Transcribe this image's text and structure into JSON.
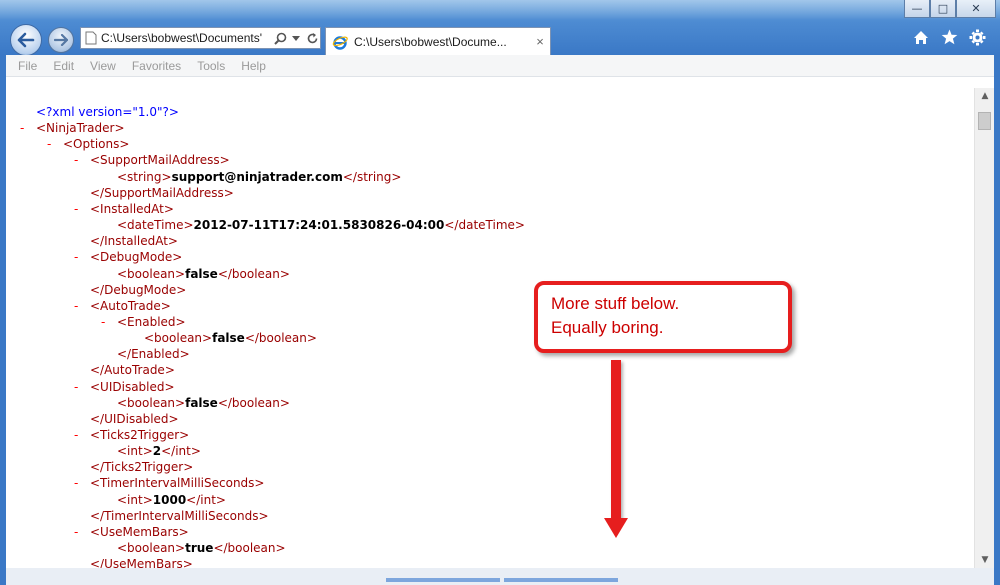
{
  "browser": {
    "address": "C:\\Users\\bobwest\\Documents'",
    "tab_title": "C:\\Users\\bobwest\\Docume...",
    "tab_close": "×",
    "window_buttons": {
      "minimize": "—",
      "maximize": "□",
      "close": "✕"
    },
    "icons": [
      "back-arrow-icon",
      "forward-arrow-icon",
      "page-icon",
      "search-icon",
      "dropdown-icon",
      "refresh-icon",
      "ie-logo-icon",
      "home-icon",
      "favorites-star-icon",
      "settings-gear-icon"
    ]
  },
  "menu": {
    "items": [
      "File",
      "Edit",
      "View",
      "Favorites",
      "Tools",
      "Help"
    ]
  },
  "xml": {
    "lines": [
      {
        "level": 0,
        "dash": "",
        "parts": [
          [
            "pi",
            "<?xml version=\"1.0\"?>"
          ]
        ]
      },
      {
        "level": 0,
        "dash": "-",
        "parts": [
          [
            "tg",
            "<NinjaTrader>"
          ]
        ]
      },
      {
        "level": 1,
        "dash": "-",
        "parts": [
          [
            "tg",
            "<Options>"
          ]
        ]
      },
      {
        "level": 2,
        "dash": "-",
        "parts": [
          [
            "tg",
            "<SupportMailAddress>"
          ]
        ]
      },
      {
        "level": 3,
        "dash": "",
        "parts": [
          [
            "tg",
            "<string>"
          ],
          [
            "tx",
            "support@ninjatrader.com"
          ],
          [
            "tg",
            "</string>"
          ]
        ]
      },
      {
        "level": 2,
        "dash": "",
        "parts": [
          [
            "tg",
            "</SupportMailAddress>"
          ]
        ]
      },
      {
        "level": 2,
        "dash": "-",
        "parts": [
          [
            "tg",
            "<InstalledAt>"
          ]
        ]
      },
      {
        "level": 3,
        "dash": "",
        "parts": [
          [
            "tg",
            "<dateTime>"
          ],
          [
            "tx",
            "2012-07-11T17:24:01.5830826-04:00"
          ],
          [
            "tg",
            "</dateTime>"
          ]
        ]
      },
      {
        "level": 2,
        "dash": "",
        "parts": [
          [
            "tg",
            "</InstalledAt>"
          ]
        ]
      },
      {
        "level": 2,
        "dash": "-",
        "parts": [
          [
            "tg",
            "<DebugMode>"
          ]
        ]
      },
      {
        "level": 3,
        "dash": "",
        "parts": [
          [
            "tg",
            "<boolean>"
          ],
          [
            "tx",
            "false"
          ],
          [
            "tg",
            "</boolean>"
          ]
        ]
      },
      {
        "level": 2,
        "dash": "",
        "parts": [
          [
            "tg",
            "</DebugMode>"
          ]
        ]
      },
      {
        "level": 2,
        "dash": "-",
        "parts": [
          [
            "tg",
            "<AutoTrade>"
          ]
        ]
      },
      {
        "level": 3,
        "dash": "-",
        "parts": [
          [
            "tg",
            "<Enabled>"
          ]
        ]
      },
      {
        "level": 4,
        "dash": "",
        "parts": [
          [
            "tg",
            "<boolean>"
          ],
          [
            "tx",
            "false"
          ],
          [
            "tg",
            "</boolean>"
          ]
        ]
      },
      {
        "level": 3,
        "dash": "",
        "parts": [
          [
            "tg",
            "</Enabled>"
          ]
        ]
      },
      {
        "level": 2,
        "dash": "",
        "parts": [
          [
            "tg",
            "</AutoTrade>"
          ]
        ]
      },
      {
        "level": 2,
        "dash": "-",
        "parts": [
          [
            "tg",
            "<UIDisabled>"
          ]
        ]
      },
      {
        "level": 3,
        "dash": "",
        "parts": [
          [
            "tg",
            "<boolean>"
          ],
          [
            "tx",
            "false"
          ],
          [
            "tg",
            "</boolean>"
          ]
        ]
      },
      {
        "level": 2,
        "dash": "",
        "parts": [
          [
            "tg",
            "</UIDisabled>"
          ]
        ]
      },
      {
        "level": 2,
        "dash": "-",
        "parts": [
          [
            "tg",
            "<Ticks2Trigger>"
          ]
        ]
      },
      {
        "level": 3,
        "dash": "",
        "parts": [
          [
            "tg",
            "<int>"
          ],
          [
            "tx",
            "2"
          ],
          [
            "tg",
            "</int>"
          ]
        ]
      },
      {
        "level": 2,
        "dash": "",
        "parts": [
          [
            "tg",
            "</Ticks2Trigger>"
          ]
        ]
      },
      {
        "level": 2,
        "dash": "-",
        "parts": [
          [
            "tg",
            "<TimerIntervalMilliSeconds>"
          ]
        ]
      },
      {
        "level": 3,
        "dash": "",
        "parts": [
          [
            "tg",
            "<int>"
          ],
          [
            "tx",
            "1000"
          ],
          [
            "tg",
            "</int>"
          ]
        ]
      },
      {
        "level": 2,
        "dash": "",
        "parts": [
          [
            "tg",
            "</TimerIntervalMilliSeconds>"
          ]
        ]
      },
      {
        "level": 2,
        "dash": "-",
        "parts": [
          [
            "tg",
            "<UseMemBars>"
          ]
        ]
      },
      {
        "level": 3,
        "dash": "",
        "parts": [
          [
            "tg",
            "<boolean>"
          ],
          [
            "tx",
            "true"
          ],
          [
            "tg",
            "</boolean>"
          ]
        ]
      },
      {
        "level": 2,
        "dash": "",
        "parts": [
          [
            "tg",
            "</UseMemBars>"
          ]
        ]
      }
    ]
  },
  "callout": {
    "line1": "More stuff below.",
    "line2": "Equally boring.",
    "color": "#e61e1e"
  },
  "colors": {
    "tag": "#990000",
    "processing_instruction": "#0000ff",
    "text_value": "#000000",
    "collapse_dash": "#ff0000",
    "chrome_blue": "#3a78c6"
  }
}
